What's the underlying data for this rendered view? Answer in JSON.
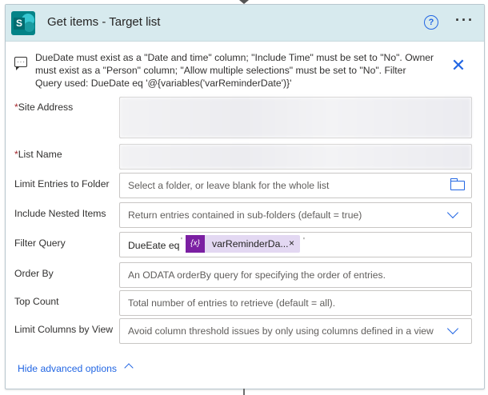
{
  "action": {
    "title": "Get items - Target list",
    "icons": {
      "logo": "sharepoint-logo",
      "help": "help-icon",
      "more": "more-options-icon"
    },
    "help_glyph": "?",
    "logo_letter": "S"
  },
  "notice": {
    "text": "DueDate must exist as a \"Date and time\" column; \"Include Time\" must be set to \"No\". Owner must exist as a \"Person\" column; \"Allow multiple selections\" must be set to \"No\". Filter Query used: DueDate eq '@{variables('varReminderDate')}'",
    "close_glyph": "✕"
  },
  "fields": {
    "site_address": {
      "label": "Site Address",
      "required": "*"
    },
    "list_name": {
      "label": "List Name",
      "required": "*"
    },
    "limit_folder": {
      "label": "Limit Entries to Folder",
      "placeholder": "Select a folder, or leave blank for the whole list"
    },
    "nested_items": {
      "label": "Include Nested Items",
      "value": "Return entries contained in sub-folders (default = true)"
    },
    "filter_query": {
      "label": "Filter Query",
      "prefix": "DueEate eq",
      "token_label": "varReminderDa...",
      "token_icon": "{x}",
      "token_remove": "×",
      "quote_open": "'",
      "quote_close": "'"
    },
    "order_by": {
      "label": "Order By",
      "placeholder": "An ODATA orderBy query for specifying the order of entries."
    },
    "top_count": {
      "label": "Top Count",
      "placeholder": "Total number of entries to retrieve (default = all)."
    },
    "limit_columns": {
      "label": "Limit Columns by View",
      "value": "Avoid column threshold issues by only using columns defined in a view"
    }
  },
  "advanced": {
    "label": "Hide advanced options"
  },
  "colors": {
    "accent": "#2266e3",
    "header": "#d7eaee",
    "token": "#e3d8f2",
    "token_icon": "#7b1fa2",
    "required": "#a4262c"
  }
}
